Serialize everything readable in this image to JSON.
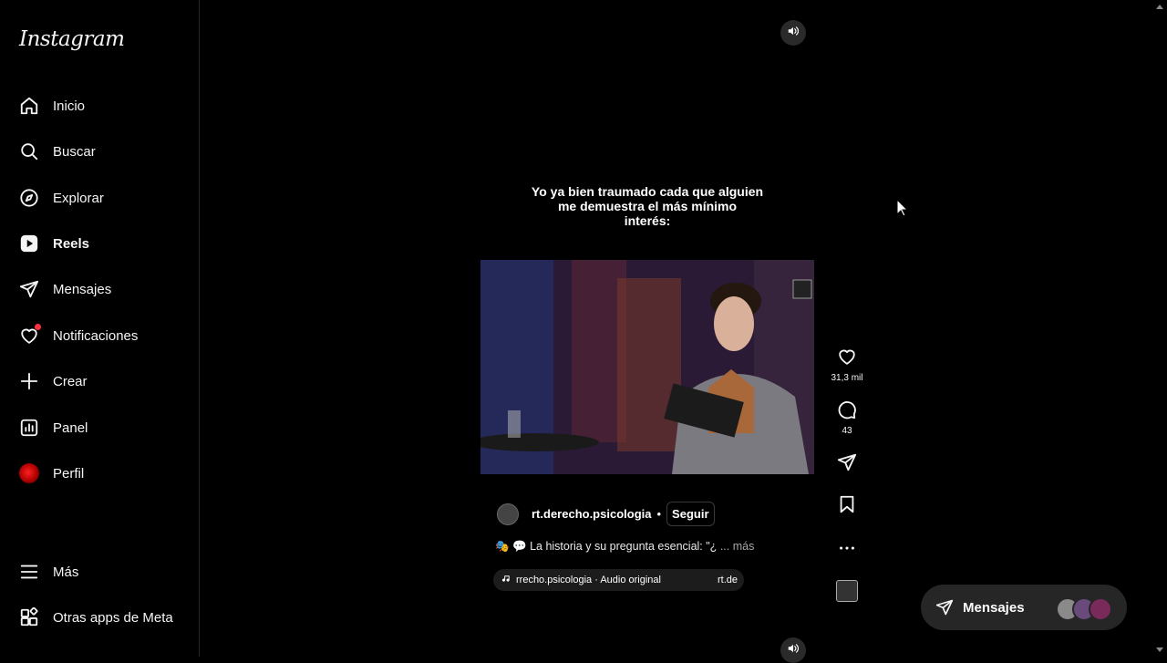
{
  "app": {
    "logo_text": "Instagram"
  },
  "sidebar": {
    "items": [
      {
        "label": "Inicio",
        "icon": "home-icon"
      },
      {
        "label": "Buscar",
        "icon": "search-icon"
      },
      {
        "label": "Explorar",
        "icon": "compass-icon"
      },
      {
        "label": "Reels",
        "icon": "reels-icon",
        "active": true
      },
      {
        "label": "Mensajes",
        "icon": "send-icon"
      },
      {
        "label": "Notificaciones",
        "icon": "heart-icon",
        "badge": "dot"
      },
      {
        "label": "Crear",
        "icon": "plus-icon"
      },
      {
        "label": "Panel",
        "icon": "chart-icon"
      },
      {
        "label": "Perfil",
        "icon": "avatar"
      }
    ],
    "bottom_items": [
      {
        "label": "Más",
        "icon": "menu-icon"
      },
      {
        "label": "Otras apps de Meta",
        "icon": "apps-icon"
      }
    ]
  },
  "reel": {
    "overlay_text_line1": "Yo ya bien traumado cada que alguien",
    "overlay_text_line2": "me demuestra el más mínimo",
    "overlay_text_line3": "interés:",
    "author": "rt.derecho.psicologia",
    "separator": "•",
    "follow_label": "Seguir",
    "description": "🎭 💬 La historia y su pregunta esencial: \"¿",
    "more_label": "... más",
    "audio_text": "rrecho.psicologia · Audio original",
    "audio_tail": "rt.de",
    "likes": "31,3 mil",
    "comments": "43"
  },
  "messages_pill": {
    "label": "Mensajes"
  },
  "colors": {
    "accent_notification": "#ff3040",
    "background": "#000000",
    "pill": "#262626"
  }
}
